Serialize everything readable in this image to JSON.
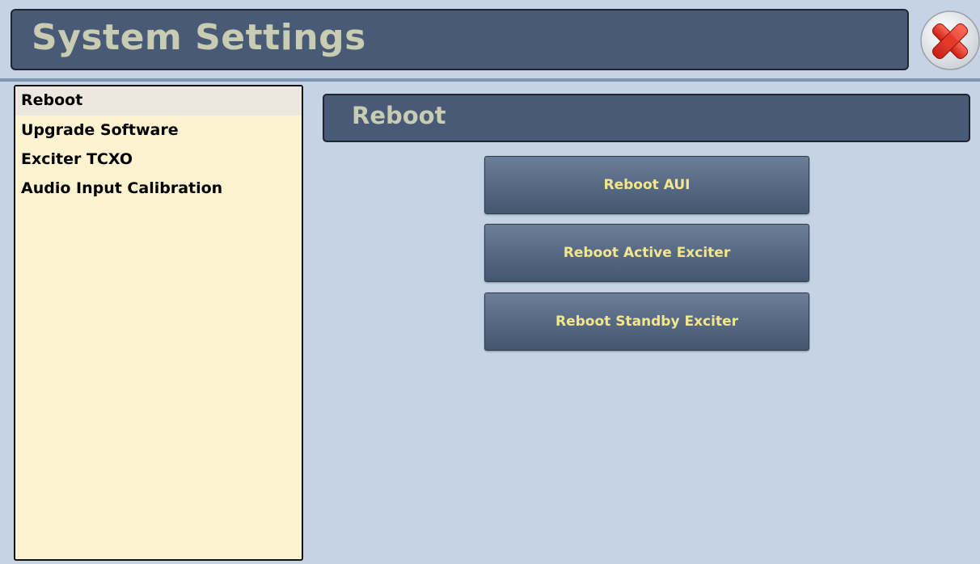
{
  "window": {
    "title": "System Settings",
    "close_icon": "close-x-icon",
    "colors": {
      "header_bg": "#485a75",
      "header_text": "#c7ccb3",
      "background": "#c5d3e4",
      "sidebar_bg": "#fdf3d0",
      "button_text": "#f4e68a",
      "close_red": "#d42a1e"
    }
  },
  "sidebar": {
    "items": [
      {
        "label": "Reboot",
        "selected": true
      },
      {
        "label": "Upgrade Software",
        "selected": false
      },
      {
        "label": "Exciter TCXO",
        "selected": false
      },
      {
        "label": "Audio Input Calibration",
        "selected": false
      }
    ]
  },
  "main": {
    "section_title": "Reboot",
    "buttons": [
      {
        "label": "Reboot AUI"
      },
      {
        "label": "Reboot Active Exciter"
      },
      {
        "label": "Reboot Standby Exciter"
      }
    ]
  }
}
